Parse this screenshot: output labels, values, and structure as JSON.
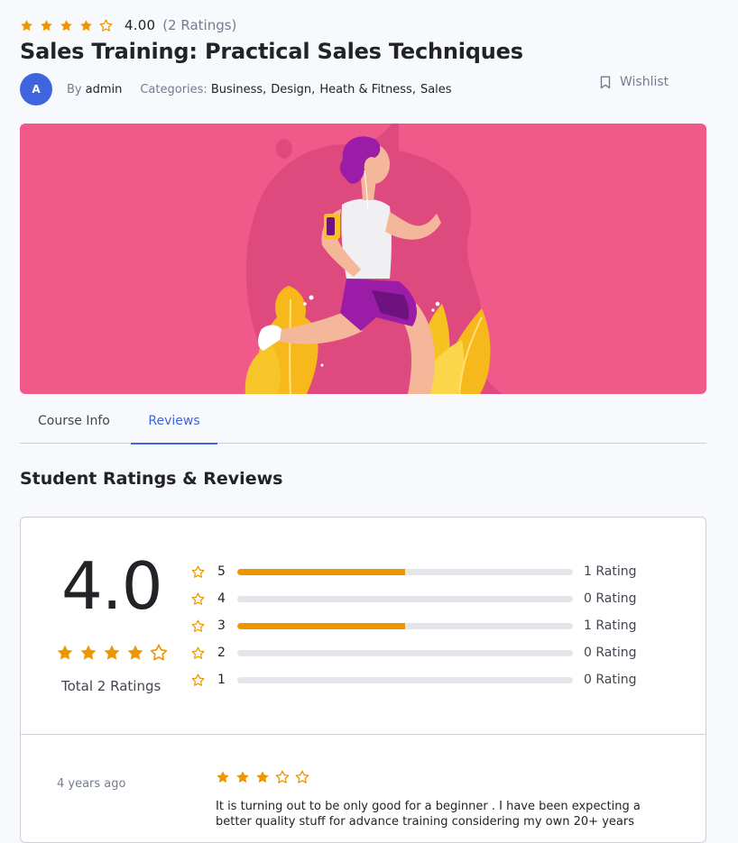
{
  "course": {
    "rating_value": "4.00",
    "rating_count": "(2 Ratings)",
    "rating_stars": 4,
    "title": "Sales Training: Practical Sales Techniques",
    "avatar_letter": "A",
    "by_label": "By",
    "author": "admin",
    "categories_label": "Categories:",
    "categories": [
      "Business",
      "Design",
      "Heath & Fitness",
      "Sales"
    ],
    "wishlist_label": "Wishlist"
  },
  "tabs": [
    {
      "label": "Course Info",
      "active": false
    },
    {
      "label": "Reviews",
      "active": true
    }
  ],
  "reviews": {
    "section_title": "Student Ratings & Reviews",
    "average": "4.0",
    "average_stars": 4,
    "total_label": "Total 2 Ratings",
    "breakdown": [
      {
        "stars": "5",
        "fraction": 0.5,
        "label": "1 Rating"
      },
      {
        "stars": "4",
        "fraction": 0,
        "label": "0 Rating"
      },
      {
        "stars": "3",
        "fraction": 0.5,
        "label": "1 Rating"
      },
      {
        "stars": "2",
        "fraction": 0,
        "label": "0 Rating"
      },
      {
        "stars": "1",
        "fraction": 0,
        "label": "0 Rating"
      }
    ],
    "items": [
      {
        "date": "4 years ago",
        "stars": 3,
        "text": "It is turning out to be only good for a beginner . I have been expecting a better quality stuff for advance training considering my own 20+ years"
      }
    ]
  },
  "colors": {
    "accent": "#3e64de",
    "star": "#ed9700",
    "hero_bg": "#f0598a"
  }
}
